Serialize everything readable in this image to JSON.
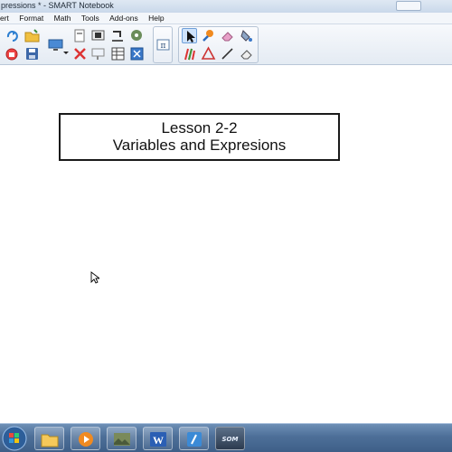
{
  "window": {
    "title": "pressions * - SMART Notebook"
  },
  "menu": {
    "items": [
      "ert",
      "Format",
      "Math",
      "Tools",
      "Add-ons",
      "Help"
    ]
  },
  "toolbar": {
    "buttons": [
      "redo-icon",
      "open-folder-icon",
      "screen-shade-icon",
      "delete-icon",
      "undo-icon",
      "save-icon",
      "display-icon",
      "paste-icon",
      "capture-icon",
      "table-icon",
      "properties-icon",
      "fullscreen-icon",
      "math-icon",
      "select-icon",
      "magic-pen-icon",
      "eraser-icon",
      "fill-icon",
      "pens-icon",
      "creative-pen-icon",
      "shapes-icon",
      "line-icon",
      "eraser-tool-icon"
    ]
  },
  "canvas": {
    "title_line1": "Lesson 2-2",
    "title_line2": "Variables and Expresions"
  },
  "taskbar": {
    "items": [
      "start-orb",
      "chrome-icon",
      "folder-icon",
      "media-player-icon",
      "photo-icon",
      "word-icon",
      "notebook-icon"
    ],
    "som_label": "SOM"
  },
  "colors": {
    "accent": "#4d6f98",
    "selected_tool": "#cfe3fb"
  }
}
